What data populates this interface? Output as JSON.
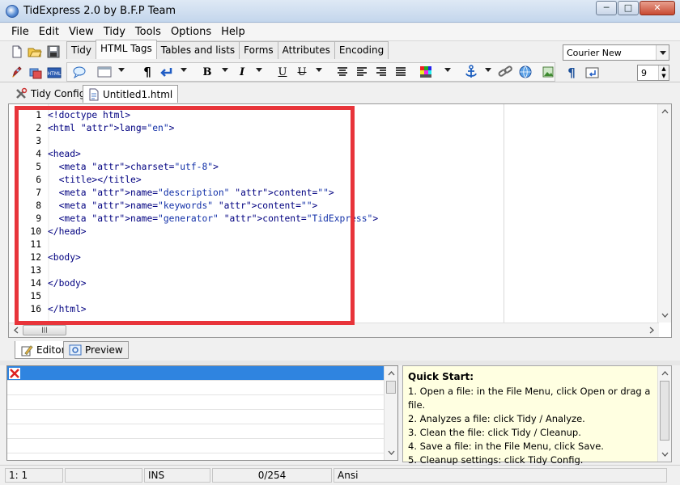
{
  "window": {
    "title": "TidExpress 2.0 by B.F.P Team",
    "minimize": "─",
    "maximize": "□",
    "close": "✕"
  },
  "menu": [
    "File",
    "Edit",
    "View",
    "Tidy",
    "Tools",
    "Options",
    "Help"
  ],
  "toolbar_tabs": [
    "Tidy",
    "HTML Tags",
    "Tables and lists",
    "Forms",
    "Attributes",
    "Encoding"
  ],
  "active_toolbar_tab": "HTML Tags",
  "font": {
    "family_value": "Courier New",
    "size_value": "9"
  },
  "doc_tabs": [
    "Tidy Config",
    "Untitled1.html"
  ],
  "active_doc_tab": "Untitled1.html",
  "editor": {
    "lines": [
      {
        "n": "1",
        "text": "<!doctype html>"
      },
      {
        "n": "2",
        "text": "<html lang=\"en\">"
      },
      {
        "n": "3",
        "text": ""
      },
      {
        "n": "4",
        "text": "<head>"
      },
      {
        "n": "5",
        "text": "  <meta charset=\"utf-8\">"
      },
      {
        "n": "6",
        "text": "  <title></title>"
      },
      {
        "n": "7",
        "text": "  <meta name=\"description\" content=\"\">"
      },
      {
        "n": "8",
        "text": "  <meta name=\"keywords\" content=\"\">"
      },
      {
        "n": "9",
        "text": "  <meta name=\"generator\" content=\"TidExpress\">"
      },
      {
        "n": "10",
        "text": "</head>"
      },
      {
        "n": "11",
        "text": ""
      },
      {
        "n": "12",
        "text": "<body>"
      },
      {
        "n": "13",
        "text": ""
      },
      {
        "n": "14",
        "text": "</body>"
      },
      {
        "n": "15",
        "text": ""
      },
      {
        "n": "16",
        "text": "</html>"
      }
    ]
  },
  "view_tabs": [
    "Editor",
    "Preview"
  ],
  "active_view_tab": "Editor",
  "quick_start": {
    "heading": "Quick Start:",
    "lines": [
      "1. Open a file: in the File Menu, click Open or drag a file.",
      "2. Analyzes a file: click Tidy / Analyze.",
      "3. Clean the file: click Tidy / Cleanup.",
      "4. Save a file: in the File Menu, click Save.",
      "5. Cleanup settings: click Tidy Config."
    ]
  },
  "status": {
    "position": "1:   1",
    "mode": "INS",
    "count": "0/254",
    "encoding": "Ansi"
  },
  "colors": {
    "highlight_box": "#e8343a",
    "selected_row": "#2f84e0",
    "quickstart_bg": "#ffffe1"
  }
}
